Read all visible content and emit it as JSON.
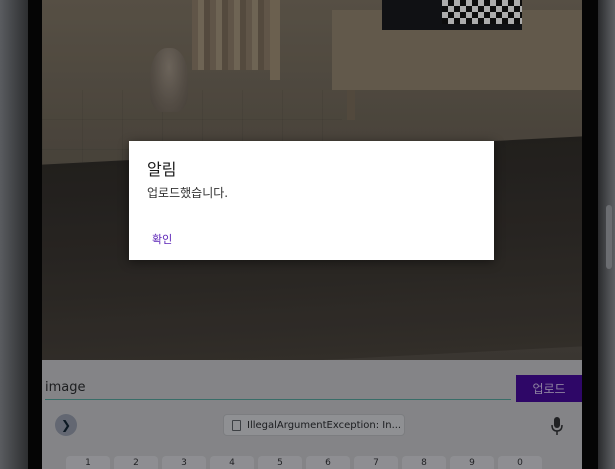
{
  "dialog": {
    "title": "알림",
    "message": "업로드했습니다.",
    "confirm_label": "확인"
  },
  "upload_form": {
    "file_input_value": "image",
    "upload_button_label": "업로드"
  },
  "keyboard": {
    "clipboard_suggestion": "IllegalArgumentException: In...",
    "number_keys": [
      "1",
      "2",
      "3",
      "4",
      "5",
      "6",
      "7",
      "8",
      "9",
      "0"
    ]
  },
  "colors": {
    "accent": "#3b0a84",
    "dialog_button": "#5a21b6",
    "input_underline": "#4a8c86"
  }
}
